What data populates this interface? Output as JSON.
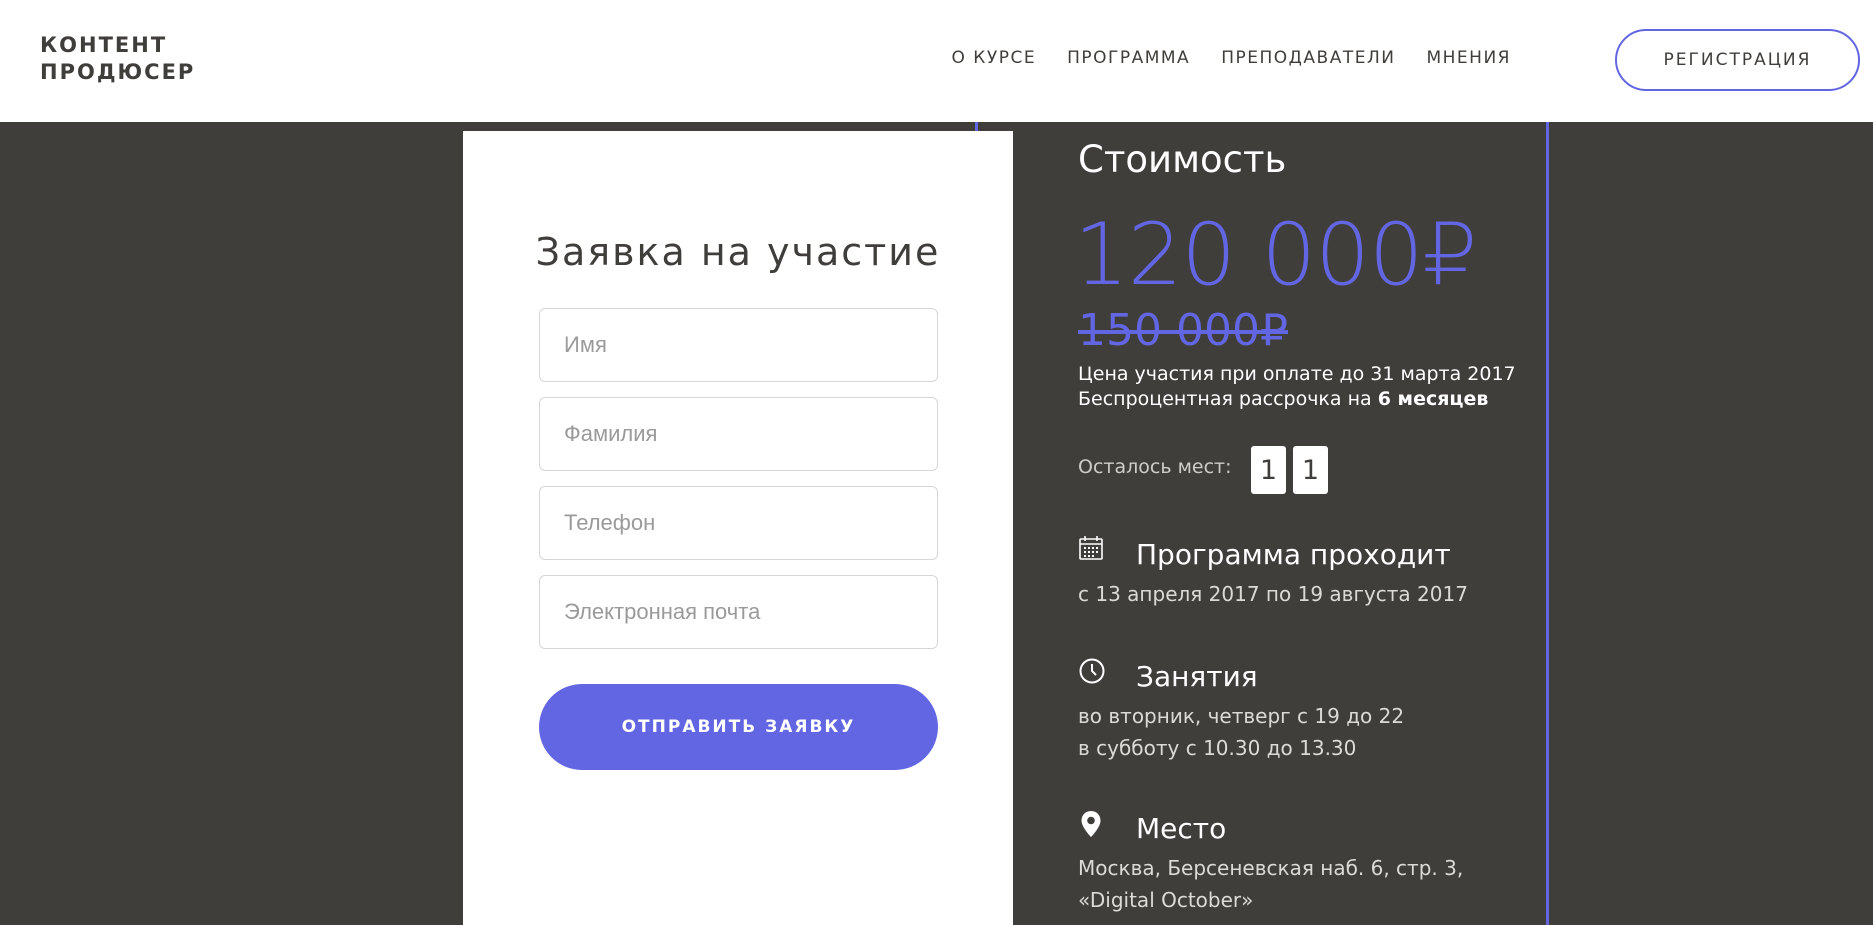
{
  "header": {
    "logo_line1": "КОНТЕНТ",
    "logo_line2": "ПРОДЮСЕР",
    "nav": [
      "О КУРСЕ",
      "ПРОГРАММА",
      "ПРЕПОДАВАТЕЛИ",
      "МНЕНИЯ"
    ],
    "register_label": "РЕГИСТРАЦИЯ"
  },
  "form": {
    "title": "Заявка на участие",
    "fields": [
      {
        "placeholder": "Имя",
        "value": ""
      },
      {
        "placeholder": "Фамилия",
        "value": ""
      },
      {
        "placeholder": "Телефон",
        "value": ""
      },
      {
        "placeholder": "Электронная почта",
        "value": ""
      }
    ],
    "submit_label": "ОТПРАВИТЬ ЗАЯВКУ"
  },
  "pricing": {
    "title": "Стоимость",
    "price_new": "120 000₽",
    "price_old": "150 000₽",
    "note_line1": "Цена участия при оплате до 31 марта 2017",
    "note_line2_prefix": "Беспроцентная рассрочка на ",
    "note_line2_bold": "6 месяцев",
    "seats_label": "Осталось мест:",
    "seats_digits": [
      "1",
      "1"
    ]
  },
  "schedule": {
    "program": {
      "icon": "calendar-icon",
      "title": "Программа проходит",
      "text1": "с 13 апреля 2017 по 19 августа 2017"
    },
    "classes": {
      "icon": "clock-icon",
      "title": "Занятия",
      "text1": "во вторник, четверг с 19 до 22",
      "text2": "в субботу с 10.30 до 13.30"
    },
    "place": {
      "icon": "map-pin-icon",
      "title": "Место",
      "text1": "Москва, Берсеневская наб. 6, стр. 3,",
      "text2": "«Digital October»"
    }
  },
  "colors": {
    "accent": "#6366e3",
    "background": "#403e3b",
    "text_dark": "#403e3b",
    "white": "#ffffff"
  }
}
